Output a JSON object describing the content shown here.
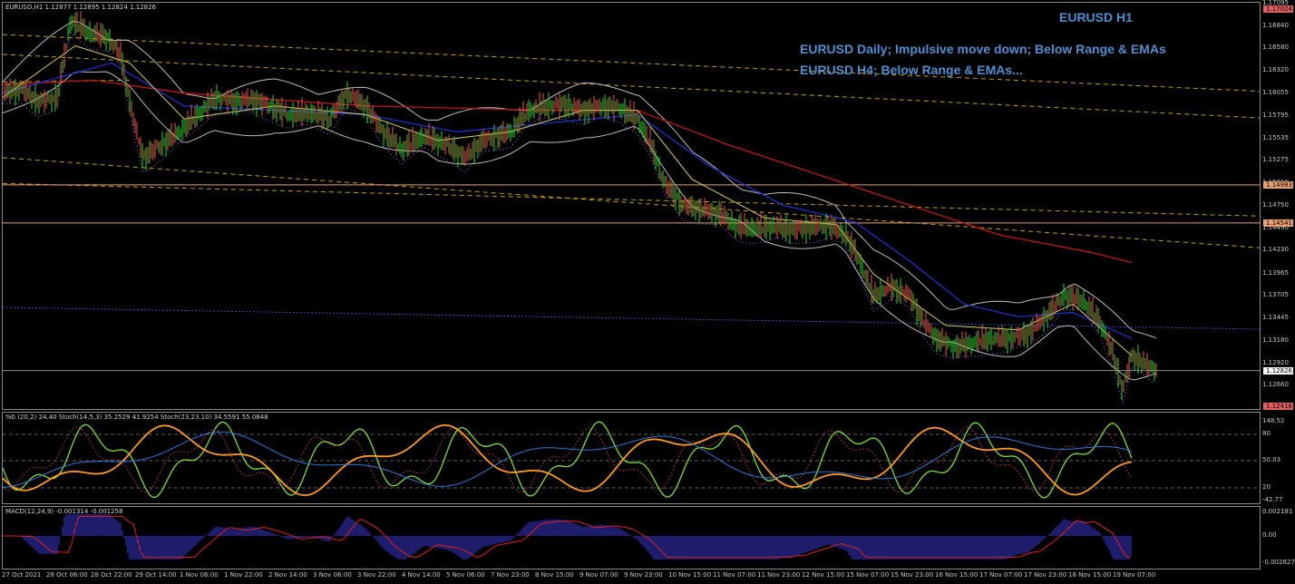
{
  "main": {
    "header": "EURUSD,H1  1.12877 1.12895 1.12824 1.12826",
    "title": "EURUSD H1",
    "notes": [
      "EURUSD Daily; Impulsive move down; Below Range & EMAs",
      "EURUSD H4; Below Range & EMAs..."
    ],
    "price_axis": [
      "1.17095",
      "1.16840",
      "1.16580",
      "1.16320",
      "1.16055",
      "1.15795",
      "1.15535",
      "1.15275",
      "1.15010",
      "1.14750",
      "1.14490",
      "1.14230",
      "1.13965",
      "1.13705",
      "1.13445",
      "1.13180",
      "1.12920",
      "1.12660"
    ],
    "price_tags": [
      {
        "text": "1.17024",
        "color": "#e06060"
      },
      {
        "text": "1.14983",
        "color": "#e8a070"
      },
      {
        "text": "1.14541",
        "color": "#e8a070"
      },
      {
        "text": "1.12826",
        "color": "#ffffff"
      },
      {
        "text": "1.12416",
        "color": "#e06060"
      }
    ]
  },
  "oscillator": {
    "header": "%b (20,2) 24.40  Stoch(14,5,3) 35.2529 41.9254  Stoch(23,23,10) 34.5591 55.0848",
    "axis": [
      "148.52",
      "80",
      "50.03",
      "20",
      "-42.77"
    ]
  },
  "macd": {
    "header": "MACD(12,24,9) -0.001314 -0.001258",
    "axis": [
      "0.002181",
      "0.00",
      "-0.002627"
    ]
  },
  "time_axis": [
    "27 Oct 2021",
    "28 Oct 06:00",
    "28 Oct 22:00",
    "29 Oct 14:00",
    "1 Nov 06:00",
    "1 Nov 22:00",
    "2 Nov 14:00",
    "3 Nov 06:00",
    "3 Nov 22:00",
    "4 Nov 14:00",
    "5 Nov 06:00",
    "7 Nov 23:00",
    "8 Nov 15:00",
    "9 Nov 07:00",
    "9 Nov 23:00",
    "10 Nov 15:00",
    "11 Nov 07:00",
    "11 Nov 23:00",
    "12 Nov 15:00",
    "15 Nov 07:00",
    "15 Nov 23:00",
    "16 Nov 15:00",
    "17 Nov 07:00",
    "17 Nov 23:00",
    "18 Nov 15:00",
    "19 Nov 07:00"
  ],
  "chart_data": {
    "type": "line",
    "symbol": "EURUSD",
    "timeframe": "H1",
    "price_path": [
      [
        0,
        1.1605
      ],
      [
        20,
        1.161
      ],
      [
        40,
        1.1595
      ],
      [
        60,
        1.16
      ],
      [
        75,
        1.169
      ],
      [
        95,
        1.1675
      ],
      [
        115,
        1.167
      ],
      [
        130,
        1.165
      ],
      [
        145,
        1.157
      ],
      [
        155,
        1.153
      ],
      [
        175,
        1.1545
      ],
      [
        195,
        1.156
      ],
      [
        215,
        1.158
      ],
      [
        235,
        1.16
      ],
      [
        255,
        1.1595
      ],
      [
        275,
        1.1598
      ],
      [
        295,
        1.159
      ],
      [
        315,
        1.158
      ],
      [
        340,
        1.1582
      ],
      [
        360,
        1.1575
      ],
      [
        380,
        1.1605
      ],
      [
        400,
        1.159
      ],
      [
        420,
        1.156
      ],
      [
        440,
        1.154
      ],
      [
        465,
        1.1555
      ],
      [
        490,
        1.1545
      ],
      [
        510,
        1.153
      ],
      [
        530,
        1.155
      ],
      [
        560,
        1.156
      ],
      [
        580,
        1.1585
      ],
      [
        600,
        1.159
      ],
      [
        620,
        1.1592
      ],
      [
        640,
        1.1585
      ],
      [
        660,
        1.159
      ],
      [
        680,
        1.1588
      ],
      [
        700,
        1.1575
      ],
      [
        715,
        1.1545
      ],
      [
        730,
        1.15
      ],
      [
        750,
        1.1475
      ],
      [
        770,
        1.147
      ],
      [
        790,
        1.1465
      ],
      [
        810,
        1.145
      ],
      [
        830,
        1.1448
      ],
      [
        850,
        1.145
      ],
      [
        870,
        1.1446
      ],
      [
        890,
        1.1449
      ],
      [
        910,
        1.1452
      ],
      [
        930,
        1.144
      ],
      [
        945,
        1.141
      ],
      [
        960,
        1.137
      ],
      [
        980,
        1.138
      ],
      [
        1000,
        1.137
      ],
      [
        1015,
        1.134
      ],
      [
        1030,
        1.132
      ],
      [
        1050,
        1.131
      ],
      [
        1070,
        1.1315
      ],
      [
        1090,
        1.132
      ],
      [
        1110,
        1.132
      ],
      [
        1130,
        1.1325
      ],
      [
        1150,
        1.1345
      ],
      [
        1170,
        1.137
      ],
      [
        1190,
        1.1365
      ],
      [
        1210,
        1.134
      ],
      [
        1225,
        1.13
      ],
      [
        1235,
        1.126
      ],
      [
        1245,
        1.13
      ],
      [
        1260,
        1.129
      ],
      [
        1272,
        1.1283
      ]
    ],
    "ma_red": [
      [
        0,
        1.1615
      ],
      [
        100,
        1.162
      ],
      [
        200,
        1.1605
      ],
      [
        400,
        1.159
      ],
      [
        600,
        1.1585
      ],
      [
        700,
        1.1585
      ],
      [
        800,
        1.1545
      ],
      [
        900,
        1.151
      ],
      [
        1000,
        1.1475
      ],
      [
        1100,
        1.144
      ],
      [
        1200,
        1.142
      ],
      [
        1245,
        1.1408
      ]
    ],
    "ma_blue": [
      [
        0,
        1.1605
      ],
      [
        120,
        1.164
      ],
      [
        200,
        1.159
      ],
      [
        300,
        1.1585
      ],
      [
        400,
        1.158
      ],
      [
        500,
        1.156
      ],
      [
        600,
        1.157
      ],
      [
        700,
        1.158
      ],
      [
        780,
        1.152
      ],
      [
        860,
        1.1475
      ],
      [
        940,
        1.1455
      ],
      [
        1000,
        1.141
      ],
      [
        1060,
        1.136
      ],
      [
        1120,
        1.1345
      ],
      [
        1180,
        1.135
      ],
      [
        1245,
        1.132
      ]
    ],
    "ma_yellow": [
      [
        0,
        1.16
      ],
      [
        80,
        1.166
      ],
      [
        140,
        1.164
      ],
      [
        200,
        1.1575
      ],
      [
        300,
        1.159
      ],
      [
        400,
        1.158
      ],
      [
        480,
        1.155
      ],
      [
        560,
        1.156
      ],
      [
        640,
        1.1585
      ],
      [
        700,
        1.1585
      ],
      [
        760,
        1.1505
      ],
      [
        840,
        1.146
      ],
      [
        920,
        1.1452
      ],
      [
        960,
        1.1395
      ],
      [
        1040,
        1.1335
      ],
      [
        1120,
        1.133
      ],
      [
        1180,
        1.136
      ],
      [
        1245,
        1.13
      ]
    ],
    "hlines": [
      {
        "price": 1.14983,
        "color": "#e8a070"
      },
      {
        "price": 1.14541,
        "color": "#e8a070"
      },
      {
        "price": 1.12826,
        "color": "#707070"
      }
    ],
    "channel_lines": [
      {
        "from": [
          0,
          1.1673
        ],
        "to": [
          1390,
          1.1607
        ]
      },
      {
        "from": [
          0,
          1.165
        ],
        "to": [
          1390,
          1.1576
        ]
      },
      {
        "from": [
          0,
          1.153
        ],
        "to": [
          1390,
          1.1425
        ]
      },
      {
        "from": [
          0,
          1.15
        ],
        "to": [
          1390,
          1.1462
        ]
      },
      {
        "from": [
          0,
          1.1618
        ],
        "to": [
          140,
          1.162
        ]
      }
    ],
    "ylim": [
      1.1238,
      1.171
    ]
  }
}
